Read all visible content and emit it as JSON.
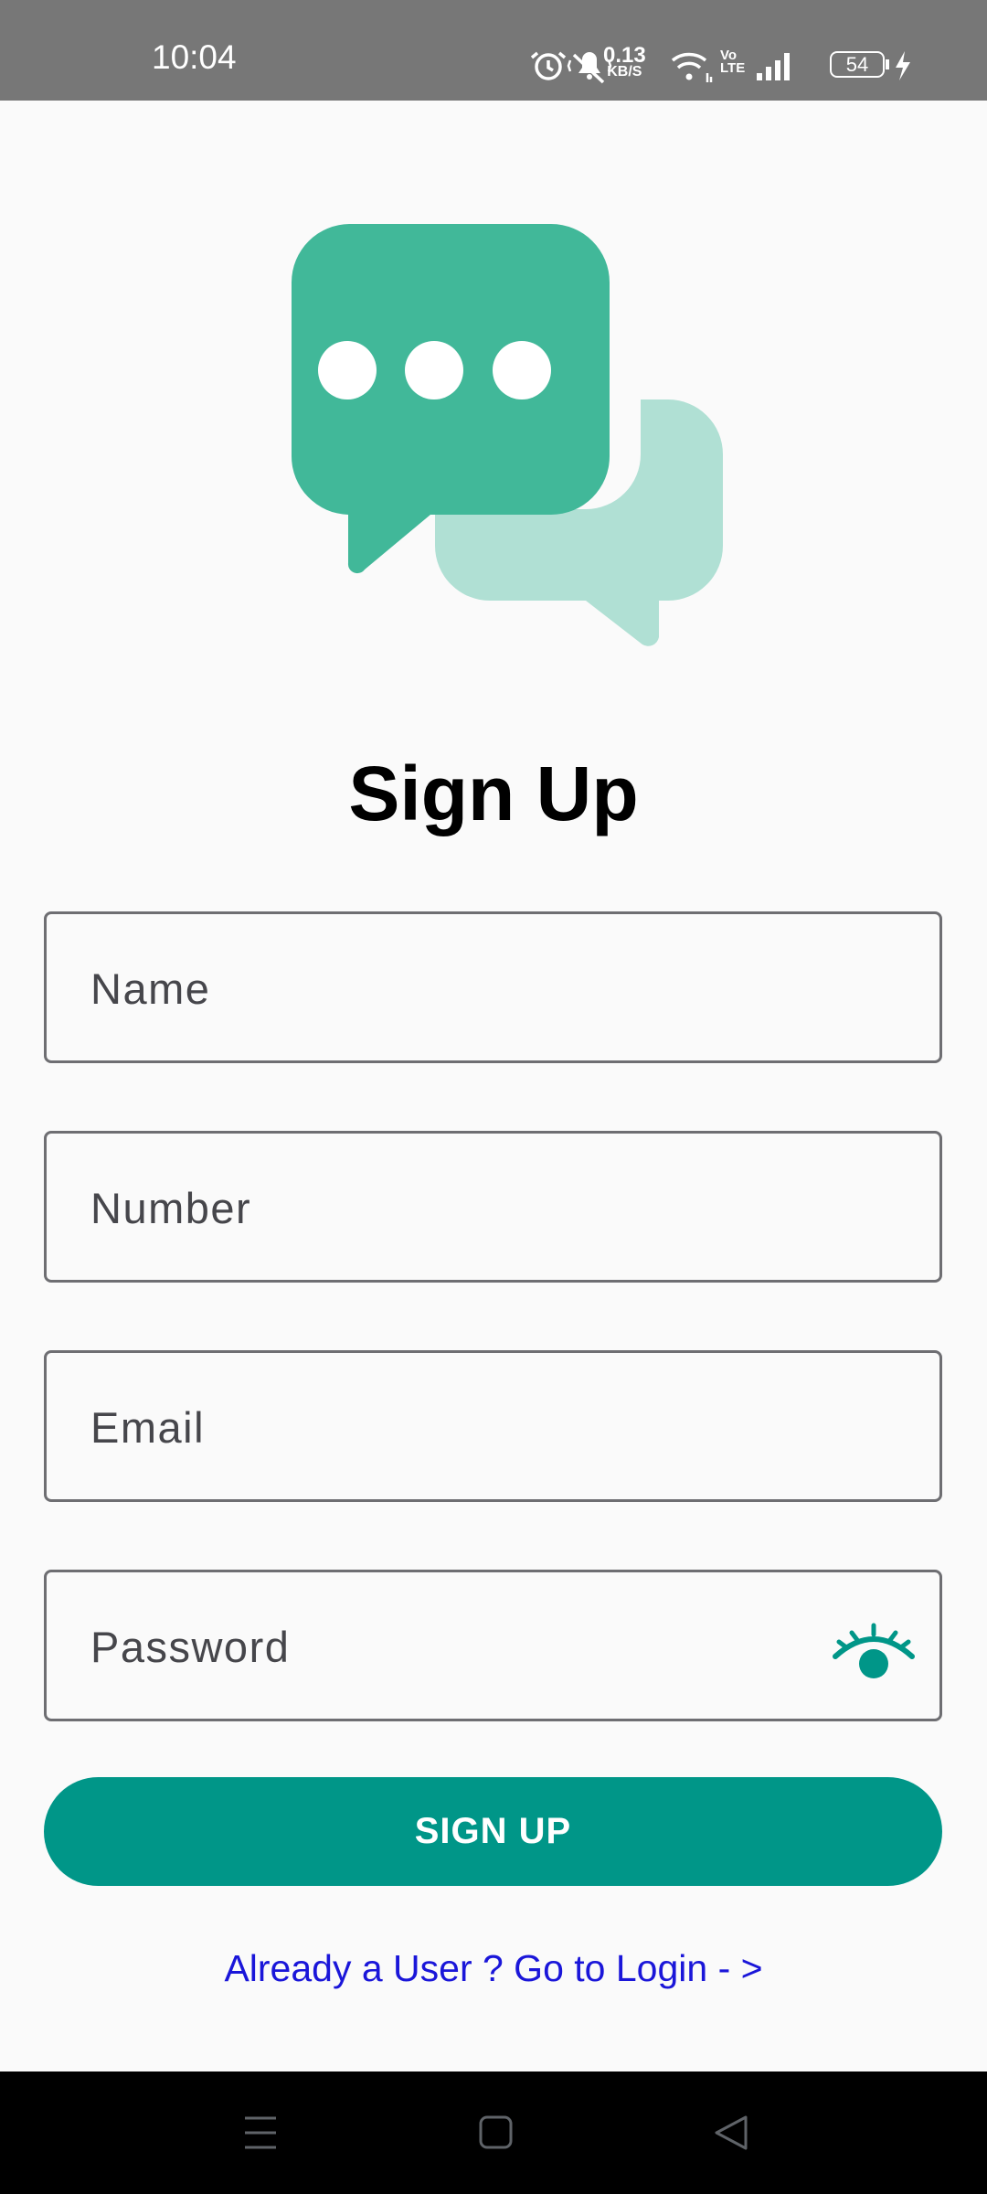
{
  "status_bar": {
    "time": "10:04",
    "net_speed_value": "0.13",
    "net_speed_unit": "KB/S",
    "volte": "Vo\nLTE",
    "battery": "54",
    "icons": [
      "alarm-icon",
      "mute-icon",
      "wifi-icon",
      "signal-icon",
      "battery-icon",
      "charging-icon"
    ]
  },
  "logo": {
    "icon": "chat-bubbles-icon",
    "colors": {
      "primary": "#41b899",
      "secondary": "#b0e0d4"
    }
  },
  "title": "Sign Up",
  "form": {
    "name_placeholder": "Name",
    "number_placeholder": "Number",
    "email_placeholder": "Email",
    "password_placeholder": "Password",
    "password_toggle_icon": "eye-icon"
  },
  "signup_button": "SIGN UP",
  "login_link": "Already a User ? Go to Login - >",
  "colors": {
    "accent": "#009688",
    "link": "#1a16d9"
  },
  "nav_bar": {
    "icons": [
      "menu-icon",
      "home-icon",
      "back-icon"
    ]
  }
}
